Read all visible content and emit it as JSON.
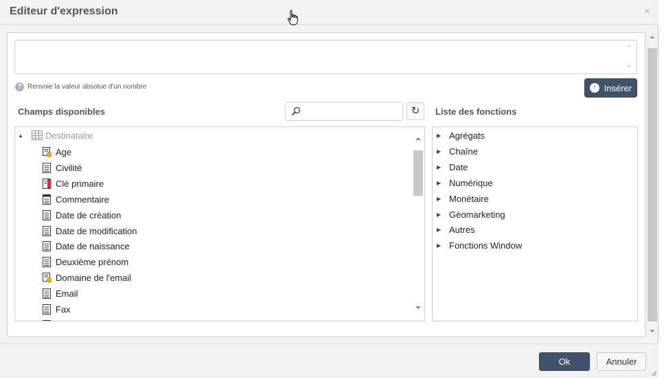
{
  "dialog": {
    "title": "Editeur d'expression",
    "close_glyph": "×"
  },
  "expression": {
    "value": "",
    "hint": "Renvoie la valeur absolue d'un nombre",
    "insert_label": "Insérer"
  },
  "fields": {
    "heading": "Champs disponibles",
    "search_placeholder": "",
    "root": "Destinataire",
    "items": [
      {
        "label": "Age",
        "icon": "computed-field-icon"
      },
      {
        "label": "Civilité",
        "icon": "text-field-icon"
      },
      {
        "label": "Clé primaire",
        "icon": "primary-key-icon"
      },
      {
        "label": "Commentaire",
        "icon": "memo-field-icon"
      },
      {
        "label": "Date de création",
        "icon": "text-field-icon"
      },
      {
        "label": "Date de modification",
        "icon": "text-field-icon"
      },
      {
        "label": "Date de naissance",
        "icon": "text-field-icon"
      },
      {
        "label": "Deuxième prénom",
        "icon": "text-field-icon"
      },
      {
        "label": "Domaine de l'email",
        "icon": "computed-field-icon"
      },
      {
        "label": "Email",
        "icon": "text-field-icon"
      },
      {
        "label": "Fax",
        "icon": "text-field-icon"
      }
    ]
  },
  "functions": {
    "heading": "Liste des fonctions",
    "items": [
      "Agrégats",
      "Chaîne",
      "Date",
      "Numérique",
      "Monétaire",
      "Géomarketing",
      "Autres",
      "Fonctions Window"
    ]
  },
  "footer": {
    "ok_label": "Ok",
    "cancel_label": "Annuler"
  },
  "colors": {
    "primary_button": "#41536b",
    "text": "#222222",
    "muted": "#999999"
  }
}
